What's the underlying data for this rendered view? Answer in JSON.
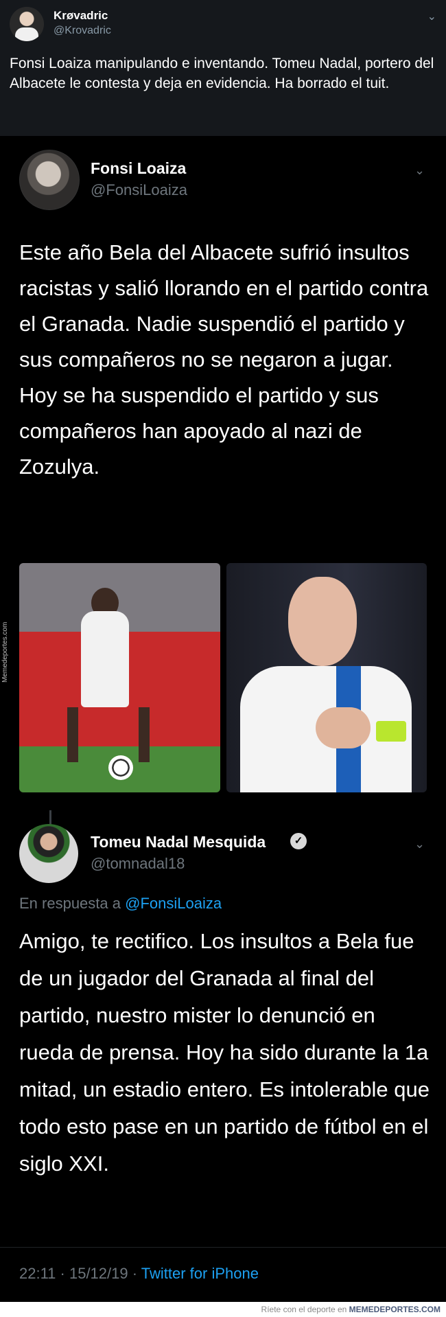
{
  "outer_tweet": {
    "name": "Krøvadric",
    "handle": "@Krovadric",
    "text": "Fonsi Loaiza manipulando e inventando. Tomeu Nadal, portero del Albacete le contesta y deja en evidencia. Ha borrado el tuit.",
    "chevron_icon": "chevron-down-icon"
  },
  "quoted_tweet": {
    "name": "Fonsi Loaiza",
    "handle": "@FonsiLoaiza",
    "text": "Este año Bela del Albacete sufrió insultos racistas y salió llorando en el partido contra el Granada. Nadie suspendió el partido y sus compañeros no se negaron a jugar. Hoy se ha suspendido el partido y sus compañeros han apoyado al nazi de Zozulya.",
    "watermark": "Memedeportes.com",
    "chevron_icon": "chevron-down-icon"
  },
  "reply_tweet": {
    "name": "Tomeu Nadal Mesquida",
    "handle": "@tomnadal18",
    "verified_icon": "verified-badge-icon",
    "reply_prefix": "En respuesta a",
    "reply_mention": "@FonsiLoaiza",
    "text": "Amigo, te rectifico. Los insultos a Bela fue de un jugador del Granada al final del partido, nuestro mister lo denunció en rueda de prensa. Hoy ha sido durante la 1a mitad, un estadio entero. Es intolerable que todo esto pase en un partido de fútbol en el siglo XXI.",
    "timestamp": "22:11 · 15/12/19 ·",
    "source": "Twitter for iPhone",
    "chevron_icon": "chevron-down-icon"
  },
  "footer": {
    "tagline": "Ríete con el deporte en",
    "brand": "MEMEDEPORTES.COM"
  },
  "colors": {
    "background": "#000000",
    "header_background": "#15181c",
    "link": "#1da1f2",
    "muted": "#6e767d"
  }
}
